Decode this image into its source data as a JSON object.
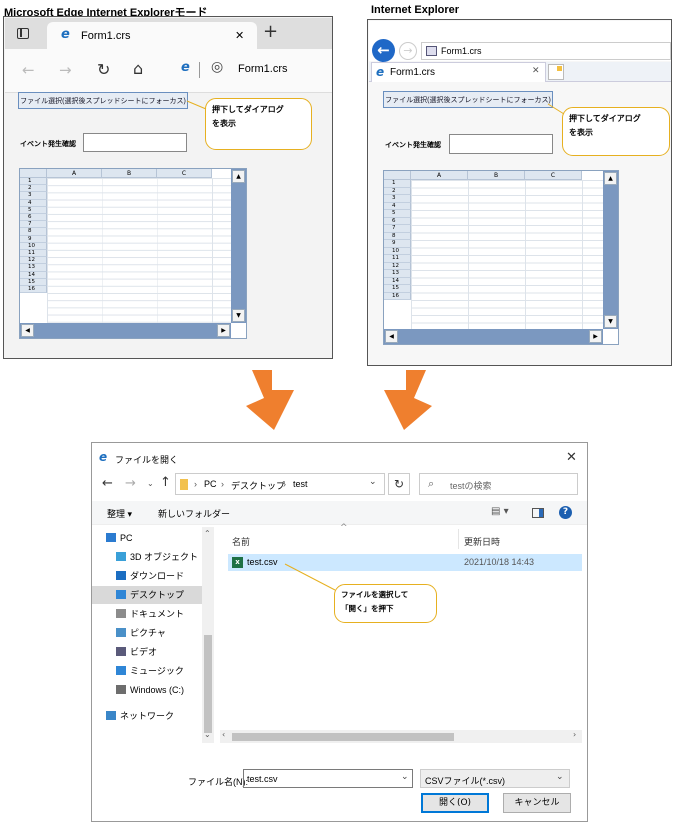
{
  "captions": {
    "edge": "Microsoft Edge Internet Explorerモード",
    "ie": "Internet Explorer"
  },
  "edge": {
    "tab_title": "Form1.crs",
    "address": "Form1.crs",
    "tab_close": "✕",
    "new_tab": "+"
  },
  "ie": {
    "address": "Form1.crs",
    "tab_title": "Form1.crs",
    "tab_close": "✕"
  },
  "form": {
    "file_button": "ファイル選択(選択後スプレッドシートにフォーカス)",
    "event_label": "イベント発生確認",
    "callout": [
      "押下してダイアログ",
      "を表示"
    ],
    "columns": [
      "A",
      "B",
      "C"
    ],
    "rows": [
      "1",
      "2",
      "3",
      "4",
      "5",
      "6",
      "7",
      "8",
      "9",
      "10",
      "11",
      "12",
      "13",
      "14",
      "15",
      "16"
    ]
  },
  "dialog": {
    "title": "ファイルを開く",
    "breadcrumb": [
      "PC",
      "デスクトップ",
      "test"
    ],
    "search_placeholder": "testの検索",
    "organize": "整理 ▾",
    "new_folder": "新しいフォルダー",
    "col_name": "名前",
    "col_date": "更新日時",
    "sidebar": [
      {
        "label": "PC",
        "icon": "pc-icon"
      },
      {
        "label": "3D オブジェクト",
        "icon": "cube-icon"
      },
      {
        "label": "ダウンロード",
        "icon": "download-icon"
      },
      {
        "label": "デスクトップ",
        "icon": "desktop-icon"
      },
      {
        "label": "ドキュメント",
        "icon": "document-icon"
      },
      {
        "label": "ピクチャ",
        "icon": "picture-icon"
      },
      {
        "label": "ビデオ",
        "icon": "video-icon"
      },
      {
        "label": "ミュージック",
        "icon": "music-icon"
      },
      {
        "label": "Windows (C:)",
        "icon": "drive-icon"
      },
      {
        "label": "ネットワーク",
        "icon": "network-icon"
      }
    ],
    "file": {
      "name": "test.csv",
      "date": "2021/10/18 14:43"
    },
    "callout": [
      "ファイルを選択して",
      "「開く」を押下"
    ],
    "filename_label": "ファイル名(N):",
    "filename_value": "test.csv",
    "filetype": "CSVファイル(*.csv)",
    "open_button": "開く(O)",
    "cancel_button": "キャンセル"
  },
  "colors": {
    "arrow": "#ef7f2e",
    "accent": "#0063b1",
    "selected_row": "#cce8ff",
    "callout_border": "#e6b020"
  }
}
